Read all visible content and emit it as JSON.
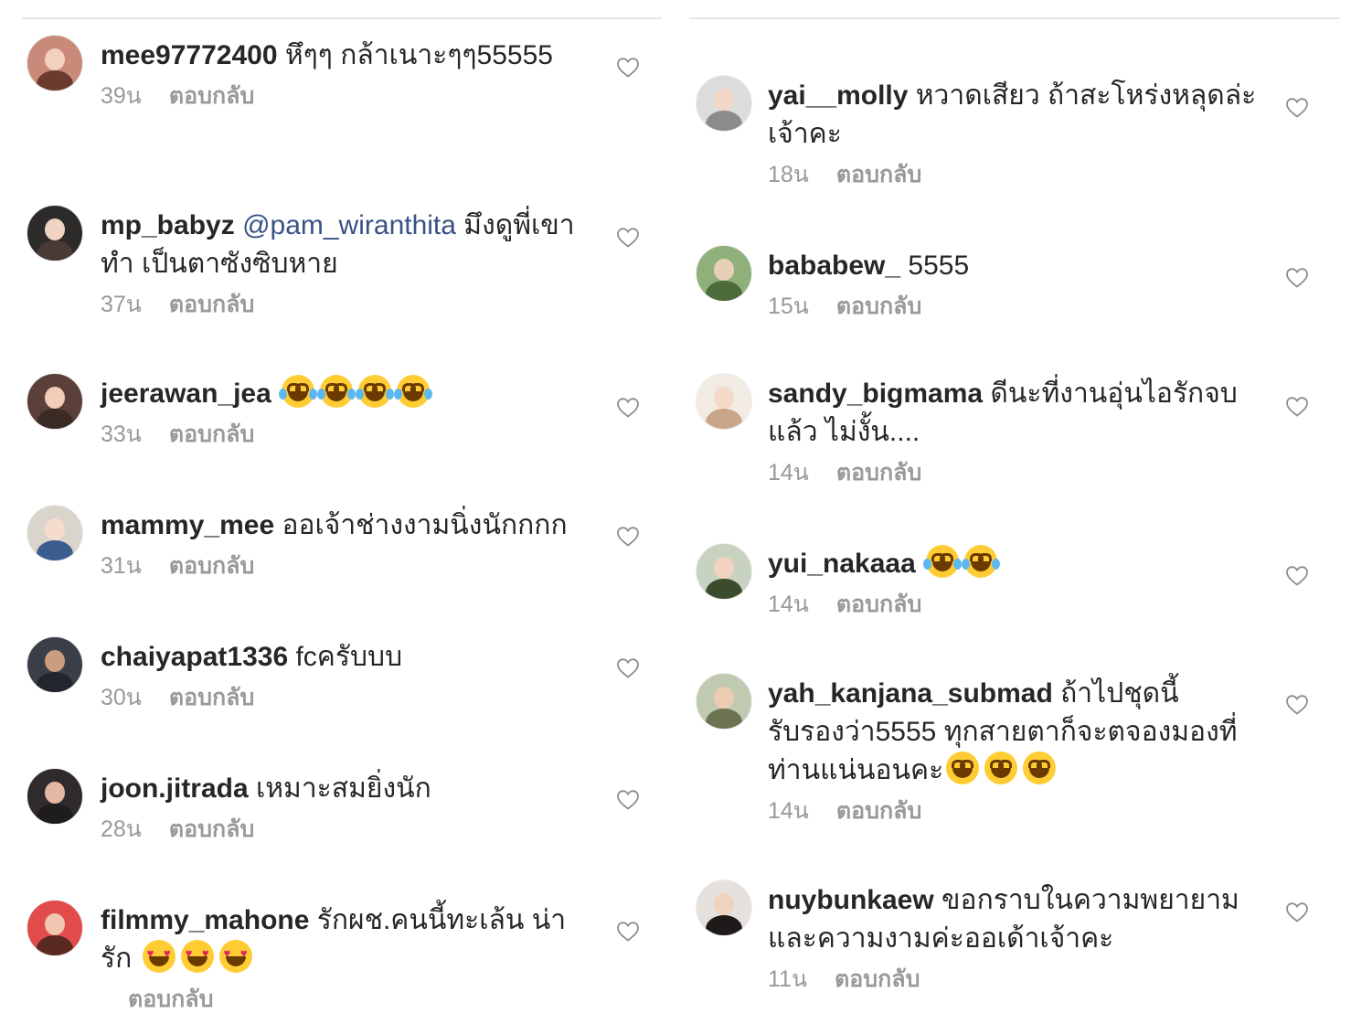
{
  "reply_label": "ตอบกลับ",
  "left_comments": [
    {
      "username": "mee97772400",
      "mention": "",
      "text": " หึๆๆ กล้าเนาะๆๆ55555",
      "emojis": [],
      "time": "39น"
    },
    {
      "username": "mp_babyz",
      "mention": "@pam_wiranthita",
      "text": " มึงดูพี่เขาทำ เป็นตาซังซิบหาย",
      "emojis": [],
      "time": "37น"
    },
    {
      "username": "jeerawan_jea",
      "mention": "",
      "text": " ",
      "emojis": [
        "laugh-tears",
        "laugh-tears",
        "laugh-tears",
        "laugh-tears"
      ],
      "time": "33น"
    },
    {
      "username": "mammy_mee",
      "mention": "",
      "text": " ออเจ้าช่างงามนิ่งนักกกก",
      "emojis": [],
      "time": "31น"
    },
    {
      "username": "chaiyapat1336",
      "mention": "",
      "text": " fcครับบบ",
      "emojis": [],
      "time": "30น"
    },
    {
      "username": "joon.jitrada",
      "mention": "",
      "text": " เหมาะสมยิ่งนัก",
      "emojis": [],
      "time": "28น"
    },
    {
      "username": "filmmy_mahone",
      "mention": "",
      "text": " รักผช.คนนี้ทะเล้น น่ารัก ",
      "emojis": [
        "heart-eyes",
        "heart-eyes",
        "heart-eyes"
      ],
      "time": ""
    }
  ],
  "right_comments": [
    {
      "username": "yai__molly",
      "mention": "",
      "text": " หวาดเสียว ถ้าสะโหร่งหลุดล่ะเจ้าคะ",
      "emojis": [],
      "time": "18น"
    },
    {
      "username": "bababew_",
      "mention": "",
      "text": " 5555",
      "emojis": [],
      "time": "15น"
    },
    {
      "username": "sandy_bigmama",
      "mention": "",
      "text": " ดีนะที่งานอุ่นไอรักจบแล้ว ไม่งั้น....",
      "emojis": [],
      "time": "14น"
    },
    {
      "username": "yui_nakaaa",
      "mention": "",
      "text": " ",
      "emojis": [
        "laugh-tears",
        "laugh-tears"
      ],
      "time": "14น"
    },
    {
      "username": "yah_kanjana_submad",
      "mention": "",
      "text": " ถ้าไปชุดนี้ รับรองว่า5555 ทุกสายตาก็จะตจองมองที่ท่านแน่นอนคะ",
      "emojis": [
        "grin-squint",
        "grin-squint",
        "grin-squint"
      ],
      "time": "14น"
    },
    {
      "username": "nuybunkaew",
      "mention": "",
      "text": " ขอกราบในความพยายามและความงามค่ะออเด้าเจ้าคะ",
      "emojis": [],
      "time": "11น"
    }
  ],
  "colors": {
    "username": "#262626",
    "mention": "#385185",
    "meta": "#999999",
    "divider": "#e6e6e6"
  }
}
